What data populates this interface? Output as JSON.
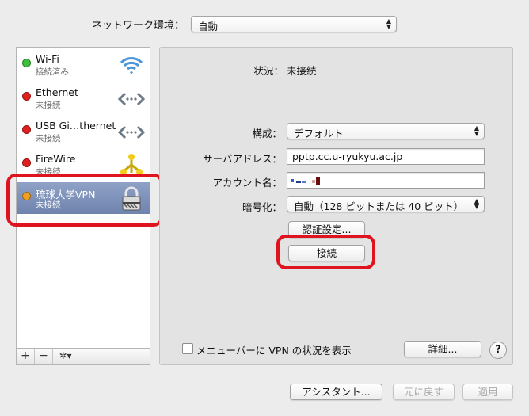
{
  "location": {
    "label": "ネットワーク環境：",
    "value": "自動"
  },
  "services": [
    {
      "name": "Wi-Fi",
      "status": "接続済み",
      "dot_color": "#3dc13d",
      "icon": "wifi-icon"
    },
    {
      "name": "Ethernet",
      "status": "未接続",
      "dot_color": "#e0201f",
      "icon": "ethernet-icon"
    },
    {
      "name": "USB Gi…thernet",
      "status": "未接続",
      "dot_color": "#e0201f",
      "icon": "ethernet-icon"
    },
    {
      "name": "FireWire",
      "status": "未接続",
      "dot_color": "#e0201f",
      "icon": "firewire-icon"
    },
    {
      "name": "琉球大学VPN",
      "status": "未接続",
      "dot_color": "#f0a020",
      "icon": "lock-icon"
    }
  ],
  "sidebar_buttons": {
    "add": "+",
    "remove": "−",
    "gear": "✲▾"
  },
  "detail": {
    "status_label": "状況：",
    "status_value": "未接続",
    "config_label": "構成：",
    "config_value": "デフォルト",
    "server_label": "サーバアドレス：",
    "server_value": "pptp.cc.u-ryukyu.ac.jp",
    "account_label": "アカウント名：",
    "encryption_label": "暗号化：",
    "encryption_value": "自動（128 ビットまたは 40 ビット）",
    "auth_button": "認証設定...",
    "connect_button": "接続",
    "show_vpn_label": "メニューバーに VPN の状況を表示",
    "advanced_button": "詳細...",
    "help": "?"
  },
  "footer": {
    "assistant": "アシスタント...",
    "revert": "元に戻す",
    "apply": "適用"
  },
  "colors": {
    "highlight": "#e0141e",
    "selected": "#7f92bb"
  }
}
